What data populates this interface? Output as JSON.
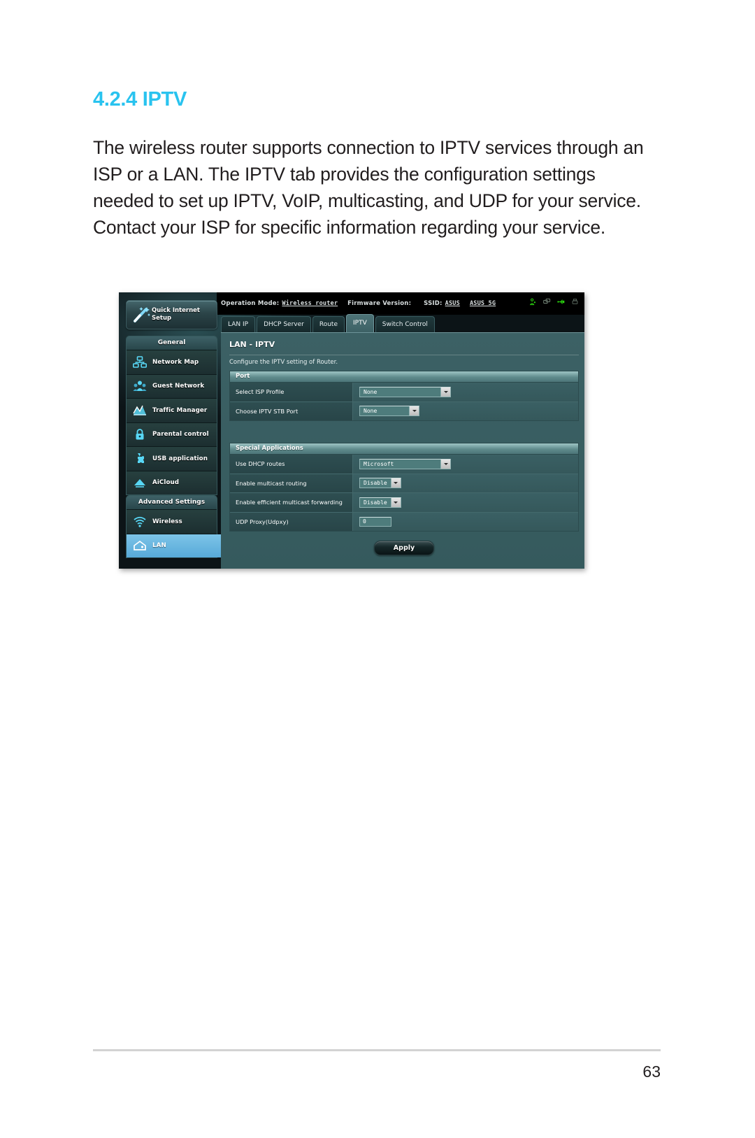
{
  "document": {
    "heading": "4.2.4 IPTV",
    "body": "The wireless router supports connection to IPTV services through an ISP or a LAN. The IPTV tab provides the configuration settings needed to set up IPTV, VoIP, multicasting, and UDP for your service. Contact your ISP for specific information regarding your service.",
    "page_number": "63"
  },
  "router_ui": {
    "topbar": {
      "operation_mode_label": "Operation Mode:",
      "operation_mode_value": "Wireless router",
      "firmware_label": "Firmware Version:",
      "firmware_value": "",
      "ssid_label": "SSID:",
      "ssid_value_1": "ASUS",
      "ssid_value_2": "ASUS_5G",
      "icons": [
        "user-group-icon",
        "network-clients-icon",
        "usb-icon",
        "printer-icon"
      ],
      "icon_color": "#2bd40f"
    },
    "quick_setup": {
      "label_line1": "Quick Internet",
      "label_line2": "Setup",
      "icon": "magic-wand-icon"
    },
    "nav": {
      "general": {
        "header": "General",
        "items": [
          {
            "label": "Network Map",
            "icon": "network-map-icon",
            "active": false
          },
          {
            "label": "Guest Network",
            "icon": "guest-network-icon",
            "active": false
          },
          {
            "label": "Traffic Manager",
            "icon": "traffic-manager-icon",
            "active": false
          },
          {
            "label": "Parental control",
            "icon": "padlock-icon",
            "active": false
          },
          {
            "label": "USB application",
            "icon": "usb-puzzle-icon",
            "active": false
          },
          {
            "label": "AiCloud",
            "icon": "aicloud-icon",
            "active": false
          }
        ]
      },
      "advanced": {
        "header": "Advanced Settings",
        "items": [
          {
            "label": "Wireless",
            "icon": "wifi-icon",
            "active": false
          },
          {
            "label": "LAN",
            "icon": "lan-home-icon",
            "active": true
          }
        ]
      },
      "active_color": "#62b0dc"
    },
    "tabs": [
      {
        "label": "LAN IP",
        "active": false
      },
      {
        "label": "DHCP Server",
        "active": false
      },
      {
        "label": "Route",
        "active": false
      },
      {
        "label": "IPTV",
        "active": true
      },
      {
        "label": "Switch Control",
        "active": false
      }
    ],
    "panel": {
      "title": "LAN - IPTV",
      "description": "Configure the IPTV setting of Router.",
      "sections": [
        {
          "header": "Port",
          "rows": [
            {
              "label": "Select ISP Profile",
              "control": "select",
              "value": "None",
              "width": "wide"
            },
            {
              "label": "Choose IPTV STB Port",
              "control": "select",
              "value": "None",
              "width": "med"
            }
          ]
        },
        {
          "header": "Special Applications",
          "rows": [
            {
              "label": "Use DHCP routes",
              "control": "select",
              "value": "Microsoft",
              "width": "wide"
            },
            {
              "label": "Enable multicast routing",
              "control": "select",
              "value": "Disable",
              "width": "auto"
            },
            {
              "label": "Enable efficient multicast forwarding",
              "control": "select",
              "value": "Disable",
              "width": "auto"
            },
            {
              "label": "UDP Proxy(Udpxy)",
              "control": "text",
              "value": "0",
              "width": "auto"
            }
          ]
        }
      ],
      "apply_label": "Apply"
    }
  }
}
